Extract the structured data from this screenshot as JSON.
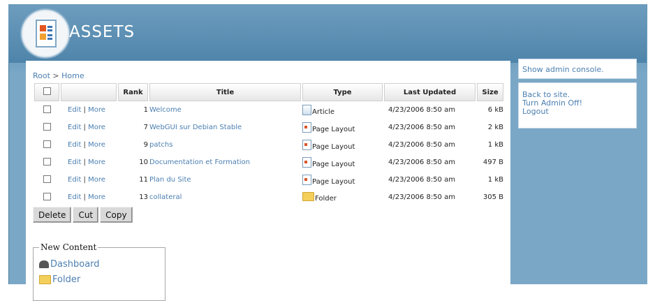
{
  "app": {
    "title": "ASSETS"
  },
  "breadcrumb": {
    "root": "Root",
    "separator": " > ",
    "current": "Home"
  },
  "table": {
    "columns": [
      "",
      "",
      "Rank",
      "Title",
      "Type",
      "Last Updated",
      "Size"
    ],
    "rows": [
      {
        "edit": "Edit",
        "sep": " | ",
        "more": "More",
        "rank": "1",
        "title": "Welcome",
        "type": "Article",
        "type_icon": "article-icon",
        "updated": "4/23/2006 8:50 am",
        "size": "6 kB"
      },
      {
        "edit": "Edit",
        "sep": " | ",
        "more": "More",
        "rank": "7",
        "title": "WebGUI sur Debian Stable",
        "type": "Page Layout",
        "type_icon": "page-layout-icon",
        "updated": "4/23/2006 8:50 am",
        "size": "2 kB"
      },
      {
        "edit": "Edit",
        "sep": " | ",
        "more": "More",
        "rank": "9",
        "title": "patchs",
        "type": "Page Layout",
        "type_icon": "page-layout-icon",
        "updated": "4/23/2006 8:50 am",
        "size": "1 kB"
      },
      {
        "edit": "Edit",
        "sep": " | ",
        "more": "More",
        "rank": "10",
        "title": "Documentation et Formation",
        "type": "Page Layout",
        "type_icon": "page-layout-icon",
        "updated": "4/23/2006 8:50 am",
        "size": "497 B"
      },
      {
        "edit": "Edit",
        "sep": " | ",
        "more": "More",
        "rank": "11",
        "title": "Plan du Site",
        "type": "Page Layout",
        "type_icon": "page-layout-icon",
        "updated": "4/23/2006 8:50 am",
        "size": "1 kB"
      },
      {
        "edit": "Edit",
        "sep": " | ",
        "more": "More",
        "rank": "13",
        "title": "collateral",
        "type": "Folder",
        "type_icon": "folder-icon",
        "updated": "4/23/2006 8:50 am",
        "size": "305 B"
      }
    ]
  },
  "actions": {
    "delete": "Delete",
    "cut": "Cut",
    "copy": "Copy"
  },
  "new_content": {
    "legend": "New Content",
    "items": [
      {
        "label": "Dashboard",
        "icon": "dashboard-icon"
      },
      {
        "label": "Folder",
        "icon": "folder-icon"
      }
    ]
  },
  "sidebar": {
    "admin_console": "Show admin console.",
    "back_to_site": "Back to site.",
    "turn_admin_off": "Turn Admin Off!",
    "logout": "Logout"
  }
}
